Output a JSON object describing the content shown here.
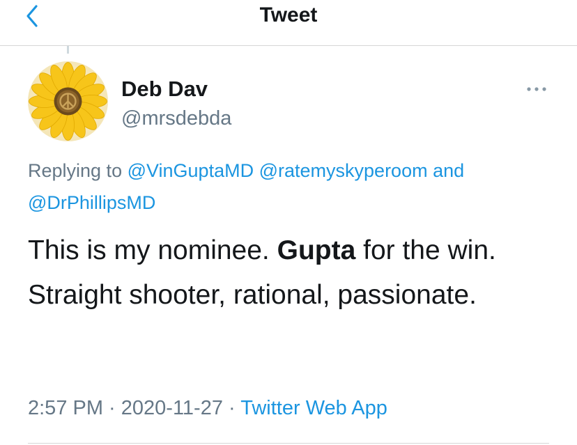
{
  "header": {
    "title": "Tweet",
    "back_icon": "chevron-left-icon"
  },
  "author": {
    "display_name": "Deb Dav",
    "handle": "@mrsdebda",
    "avatar": "sunflower-peace-avatar",
    "more_icon": "more-dots-icon"
  },
  "reply": {
    "prefix": "Replying to ",
    "mention_1": "@VinGuptaMD",
    "mention_2": "@ratemyskyperoom",
    "conjunction": "and ",
    "mention_3": "@DrPhillipsMD"
  },
  "tweet": {
    "text_1": "This is my nominee. ",
    "text_bold": "Gupta",
    "text_2": " for the win. Straight shooter, rational, passionate."
  },
  "meta": {
    "time": "2:57 PM",
    "separator": " · ",
    "date": "2020-11-27",
    "source": "Twitter Web App"
  },
  "colors": {
    "accent": "#1b95e0",
    "secondary_text": "#657786",
    "primary_text": "#14171a"
  }
}
